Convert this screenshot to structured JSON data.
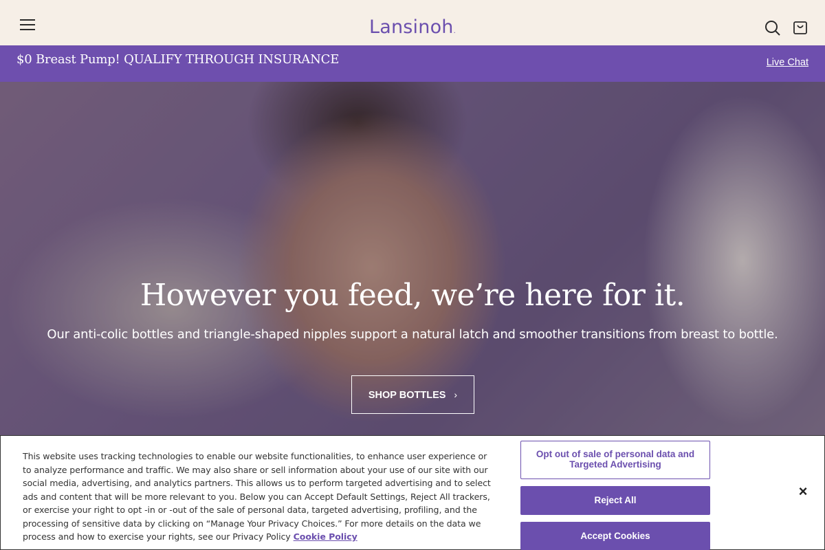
{
  "header": {
    "logo": "Lansinoh",
    "logo_mark": "."
  },
  "promo": {
    "text": "$0 Breast Pump! QUALIFY THROUGH INSURANCE",
    "live_chat": "Live Chat"
  },
  "hero": {
    "title": "However you feed, we’re here for it.",
    "subtitle": "Our anti-colic bottles and triangle-shaped nipples support a natural latch and smoother transitions from breast to bottle.",
    "cta": "SHOP BOTTLES"
  },
  "cookie_banner": {
    "text": "This website uses tracking technologies to enable our website functionalities, to enhance user experience or to analyze performance and traffic. We may also share or sell information about your use of our site with our social media, advertising, and analytics partners. This allows us to perform targeted advertising and to select ads and content that will be more relevant to you. Below you can Accept Default Settings, Reject All trackers, or exercise your right to opt -in or -out of the sale of personal data, targeted advertising, profiling, and the processing of sensitive data by clicking on “Manage Your Privacy Choices.” For more details on the data we process and how to exercise your rights, see our Privacy Policy",
    "policy_link": "Cookie Policy",
    "opt_out_label": "Opt out of sale of personal data and Targeted Advertising",
    "reject_label": "Reject All",
    "accept_label": "Accept Cookies",
    "close_label": "×"
  },
  "icons": {
    "menu": "hamburger-menu-icon",
    "search": "search-icon",
    "cart": "shopping-bag-icon",
    "cta_arrow": "chevron-right-icon",
    "close": "close-icon"
  },
  "colors": {
    "brand_purple": "#6e4fae",
    "header_bg": "#f6efe7",
    "button_purple": "#6b4fae"
  }
}
